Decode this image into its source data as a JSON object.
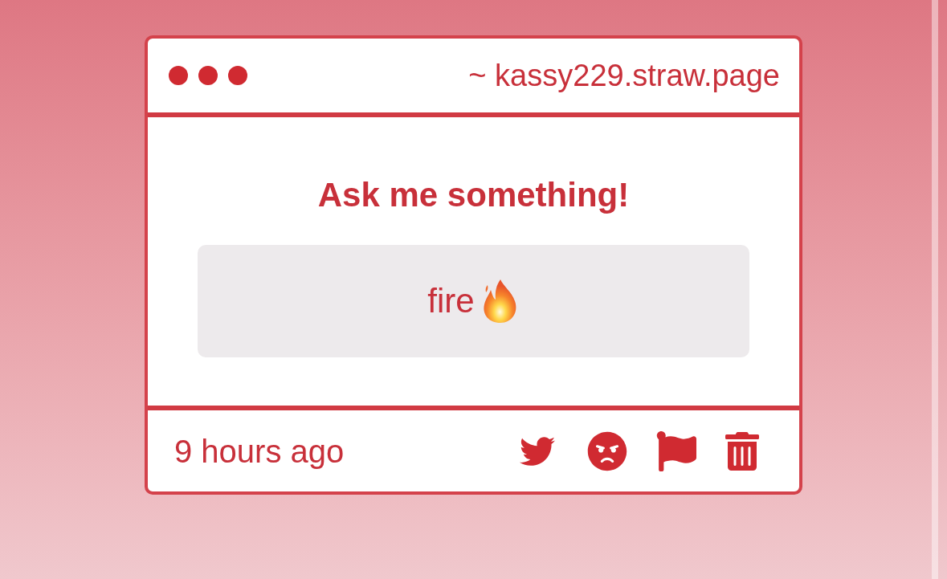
{
  "window": {
    "url": "~ kassy229.straw.page"
  },
  "prompt": {
    "title": "Ask me something!"
  },
  "answer": {
    "text": "fire"
  },
  "footer": {
    "time": "9 hours ago",
    "actions": [
      {
        "kind": "tweet"
      },
      {
        "kind": "angry"
      },
      {
        "kind": "flag"
      },
      {
        "kind": "delete"
      }
    ]
  }
}
